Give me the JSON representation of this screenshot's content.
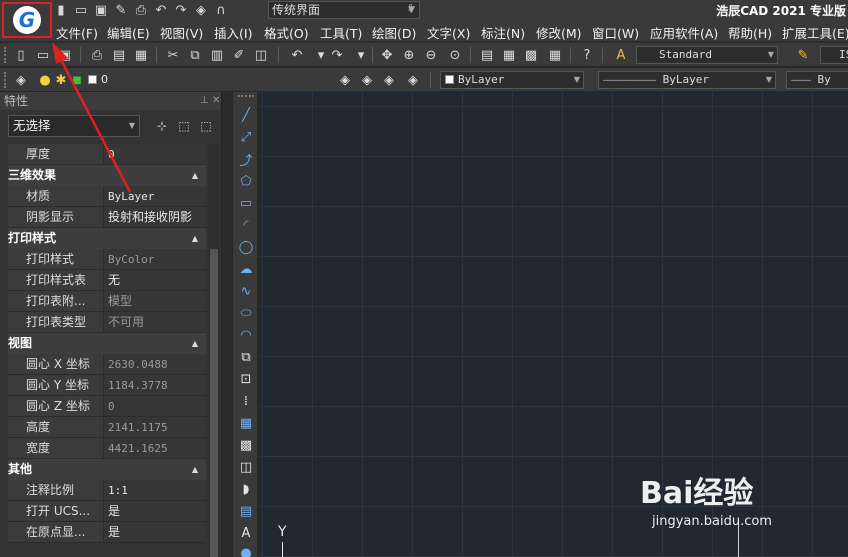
{
  "app": {
    "logo_letter": "G",
    "title": "浩辰CAD 2021 专业版",
    "workspace": "传统界面"
  },
  "menu": [
    "文件(F)",
    "编辑(E)",
    "视图(V)",
    "插入(I)",
    "格式(O)",
    "工具(T)",
    "绘图(D)",
    "文字(X)",
    "标注(N)",
    "修改(M)",
    "窗口(W)",
    "应用软件(A)",
    "帮助(H)",
    "扩展工具(E)"
  ],
  "toolbar": {
    "text_style": "Standard",
    "dim_style_partial": "IS",
    "layer_name": "0",
    "color": "ByLayer",
    "linetype": "ByLayer",
    "lineweight_partial": "By"
  },
  "palette": {
    "title": "特性",
    "selection": "无选择",
    "categories": [
      {
        "name": null,
        "rows": [
          {
            "key": "厚度",
            "value": "0",
            "dim": false,
            "zh": false
          }
        ]
      },
      {
        "name": "三维效果",
        "rows": [
          {
            "key": "材质",
            "value": "ByLayer",
            "dim": false,
            "zh": false
          },
          {
            "key": "阴影显示",
            "value": "投射和接收阴影",
            "dim": false,
            "zh": true
          }
        ]
      },
      {
        "name": "打印样式",
        "rows": [
          {
            "key": "打印样式",
            "value": "ByColor",
            "dim": true,
            "zh": false
          },
          {
            "key": "打印样式表",
            "value": "无",
            "dim": false,
            "zh": true
          },
          {
            "key": "打印表附...",
            "value": "模型",
            "dim": true,
            "zh": true
          },
          {
            "key": "打印表类型",
            "value": "不可用",
            "dim": true,
            "zh": true
          }
        ]
      },
      {
        "name": "视图",
        "rows": [
          {
            "key": "圆心 X 坐标",
            "value": "2630.0488",
            "dim": true,
            "zh": false
          },
          {
            "key": "圆心 Y 坐标",
            "value": "1184.3778",
            "dim": true,
            "zh": false
          },
          {
            "key": "圆心 Z 坐标",
            "value": "0",
            "dim": true,
            "zh": false
          },
          {
            "key": "高度",
            "value": "2141.1175",
            "dim": true,
            "zh": false
          },
          {
            "key": "宽度",
            "value": "4421.1625",
            "dim": true,
            "zh": false
          }
        ]
      },
      {
        "name": "其他",
        "rows": [
          {
            "key": "注释比例",
            "value": "1:1",
            "dim": false,
            "zh": false
          },
          {
            "key": "打开 UCS...",
            "value": "是",
            "dim": false,
            "zh": true
          },
          {
            "key": "在原点显...",
            "value": "是",
            "dim": false,
            "zh": true
          }
        ]
      }
    ]
  },
  "canvas": {
    "ucs_label": "Y"
  },
  "watermark": {
    "brand": "Bai经验",
    "url": "jingyan.baidu.com"
  },
  "colors": {
    "annotation": "#e02020",
    "canvas_bg": "#212830",
    "draw_icon": "#6fb0f0"
  }
}
